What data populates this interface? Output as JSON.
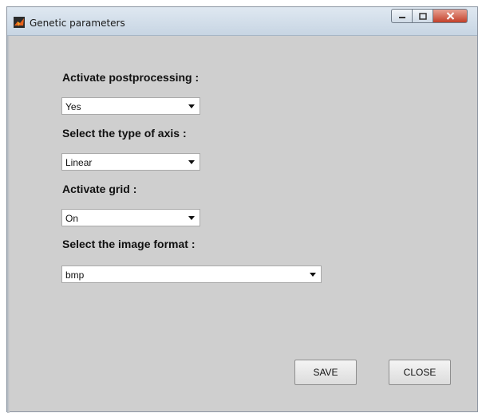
{
  "window": {
    "title": "Genetic parameters"
  },
  "form": {
    "postprocessing": {
      "label": "Activate postprocessing :",
      "value": "Yes"
    },
    "axis_type": {
      "label": "Select the type of axis :",
      "value": "Linear"
    },
    "grid": {
      "label": "Activate grid :",
      "value": "On"
    },
    "image_format": {
      "label": "Select the image format :",
      "value": "bmp"
    }
  },
  "buttons": {
    "save": "SAVE",
    "close": "CLOSE"
  },
  "icons": {
    "app": "matlab-icon",
    "minimize": "minimize-icon",
    "maximize": "maximize-icon",
    "close": "close-icon",
    "dropdown": "chevron-down-icon"
  },
  "colors": {
    "panel_bg": "#cfcfcf",
    "close_btn": "#c2402a",
    "titlebar": "#c7d5e3"
  }
}
